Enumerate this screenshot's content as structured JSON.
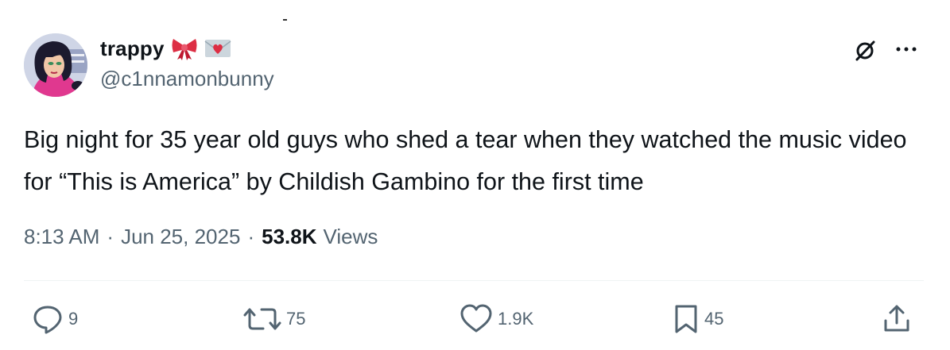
{
  "colors": {
    "text_primary": "#0f1419",
    "text_secondary": "#536471",
    "divider": "#eff3f4"
  },
  "author": {
    "display_name": "trappy",
    "handle": "@c1nnamonbunny",
    "name_emojis": [
      "ribbon-emoji",
      "love-letter-emoji"
    ]
  },
  "tweet": {
    "text": "Big night for 35 year old guys who shed a tear when they watched the music video for “This is America” by Childish Gambino for the first time",
    "time": "8:13 AM",
    "date": "Jun 25, 2025",
    "separator": "·",
    "views_count": "53.8K",
    "views_label": "Views"
  },
  "actions": {
    "reply": {
      "icon": "reply-icon",
      "count": "9"
    },
    "repost": {
      "icon": "repost-icon",
      "count": "75"
    },
    "like": {
      "icon": "heart-icon",
      "count": "1.9K"
    },
    "bookmark": {
      "icon": "bookmark-icon",
      "count": "45"
    },
    "share": {
      "icon": "share-icon"
    }
  },
  "header_icons": [
    "grok-icon",
    "more-icon"
  ]
}
